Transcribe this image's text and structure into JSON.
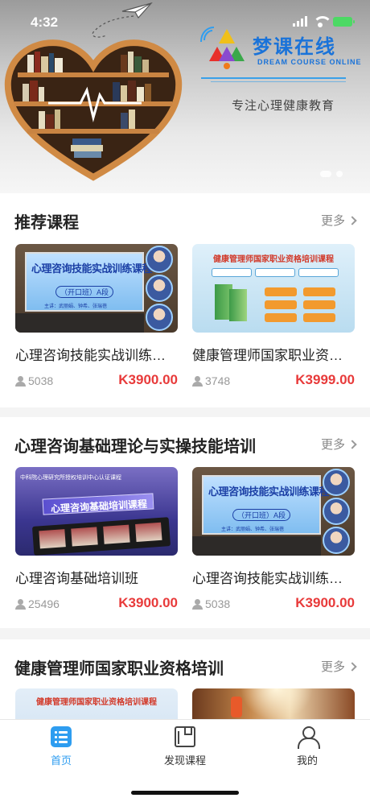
{
  "status": {
    "time": "4:32"
  },
  "banner": {
    "logo_title": "梦课在线",
    "logo_sub": "DREAM COURSE ONLINE",
    "slogan": "专注心理健康教育"
  },
  "sections": [
    {
      "title": "推荐课程",
      "more": "更多",
      "cards": [
        {
          "title": "心理咨询技能实战训练课程",
          "count": "5038",
          "price": "K3900.00",
          "thumb_title": "心理咨询技能实战训练课程",
          "thumb_badge": "（开口班）A段",
          "thumb_names": "主讲：武丽娟、钟希、张瑞蓓"
        },
        {
          "title": "健康管理师国家职业资格培训课程",
          "count": "3748",
          "price": "K3999.00",
          "thumb_title": "健康管理师国家职业资格培训课程"
        }
      ]
    },
    {
      "title": "心理咨询基础理论与实操技能培训",
      "more": "更多",
      "cards": [
        {
          "title": "心理咨询基础培训班",
          "count": "25496",
          "price": "K3900.00",
          "thumb_top": "中科院心理研究所授权培训中心认证课程",
          "thumb_title": "心理咨询基础培训课程"
        },
        {
          "title": "心理咨询技能实战训练课程",
          "count": "5038",
          "price": "K3900.00",
          "thumb_title": "心理咨询技能实战训练课程",
          "thumb_badge": "（开口班）A段",
          "thumb_names": "主讲：武丽娟、钟希、张瑞蓓"
        }
      ]
    },
    {
      "title": "健康管理师国家职业资格培训",
      "more": "更多",
      "cards": [
        {
          "thumb_title": "健康管理师国家职业资格培训课程"
        },
        {}
      ]
    }
  ],
  "tabbar": [
    {
      "label": "首页",
      "icon": "home-list-icon",
      "active": true
    },
    {
      "label": "发现课程",
      "icon": "book-icon",
      "active": false
    },
    {
      "label": "我的",
      "icon": "user-icon",
      "active": false
    }
  ],
  "colors": {
    "accent": "#2e9df0",
    "price": "#e83a3a",
    "logo": "#1a73d9"
  }
}
